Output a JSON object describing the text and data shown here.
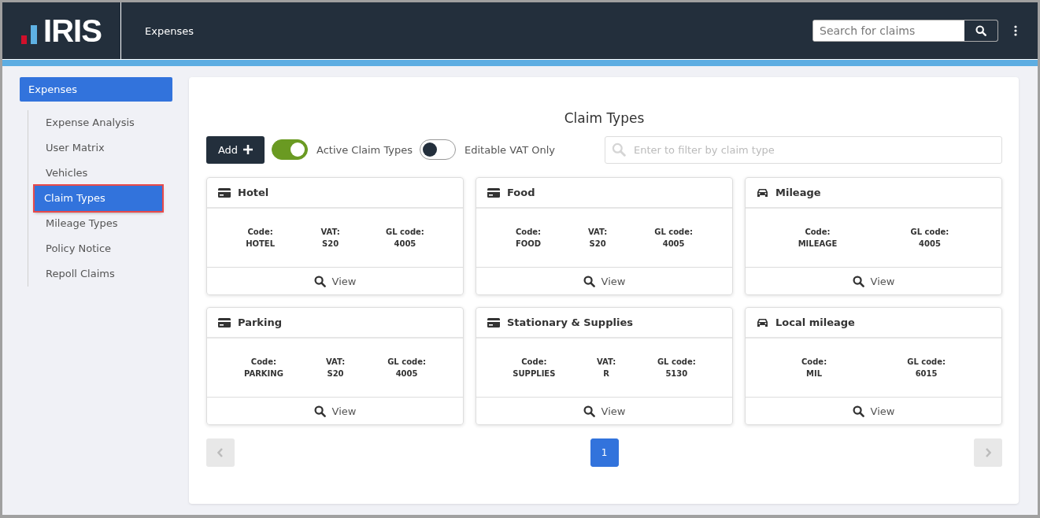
{
  "header": {
    "logo": "IRIS",
    "app_title": "Expenses",
    "search": {
      "placeholder": "Search for claims"
    }
  },
  "sidebar": {
    "heading": "Expenses",
    "items": [
      {
        "label": "Expense Analysis",
        "selected": false
      },
      {
        "label": "User Matrix",
        "selected": false
      },
      {
        "label": "Vehicles",
        "selected": false
      },
      {
        "label": "Claim Types",
        "selected": true
      },
      {
        "label": "Mileage Types",
        "selected": false
      },
      {
        "label": "Policy Notice",
        "selected": false
      },
      {
        "label": "Repoll Claims",
        "selected": false
      }
    ]
  },
  "main": {
    "title": "Claim Types",
    "add_button": "Add",
    "toggles": [
      {
        "label": "Active Claim Types",
        "on": true
      },
      {
        "label": "Editable VAT Only",
        "on": false
      }
    ],
    "filter": {
      "placeholder": "Enter to filter by claim type"
    },
    "cards": [
      {
        "title": "Hotel",
        "kind": "card",
        "fields": [
          {
            "label": "Code:",
            "value": "HOTEL"
          },
          {
            "label": "VAT:",
            "value": "S20"
          },
          {
            "label": "GL code:",
            "value": "4005"
          }
        ],
        "action": "View"
      },
      {
        "title": "Food",
        "kind": "card",
        "fields": [
          {
            "label": "Code:",
            "value": "FOOD"
          },
          {
            "label": "VAT:",
            "value": "S20"
          },
          {
            "label": "GL code:",
            "value": "4005"
          }
        ],
        "action": "View"
      },
      {
        "title": "Mileage",
        "kind": "car",
        "fields": [
          {
            "label": "Code:",
            "value": "MILEAGE"
          },
          {
            "label": "GL code:",
            "value": "4005"
          }
        ],
        "action": "View"
      },
      {
        "title": "Parking",
        "kind": "card",
        "fields": [
          {
            "label": "Code:",
            "value": "PARKING"
          },
          {
            "label": "VAT:",
            "value": "S20"
          },
          {
            "label": "GL code:",
            "value": "4005"
          }
        ],
        "action": "View"
      },
      {
        "title": "Stationary & Supplies",
        "kind": "card",
        "fields": [
          {
            "label": "Code:",
            "value": "SUPPLIES"
          },
          {
            "label": "VAT:",
            "value": "R"
          },
          {
            "label": "GL code:",
            "value": "5130"
          }
        ],
        "action": "View"
      },
      {
        "title": "Local mileage",
        "kind": "car",
        "fields": [
          {
            "label": "Code:",
            "value": "MIL"
          },
          {
            "label": "GL code:",
            "value": "6015"
          }
        ],
        "action": "View"
      }
    ],
    "pagination": {
      "prev_disabled": true,
      "next_disabled": true,
      "pages": [
        {
          "label": "1",
          "selected": true
        }
      ]
    }
  }
}
